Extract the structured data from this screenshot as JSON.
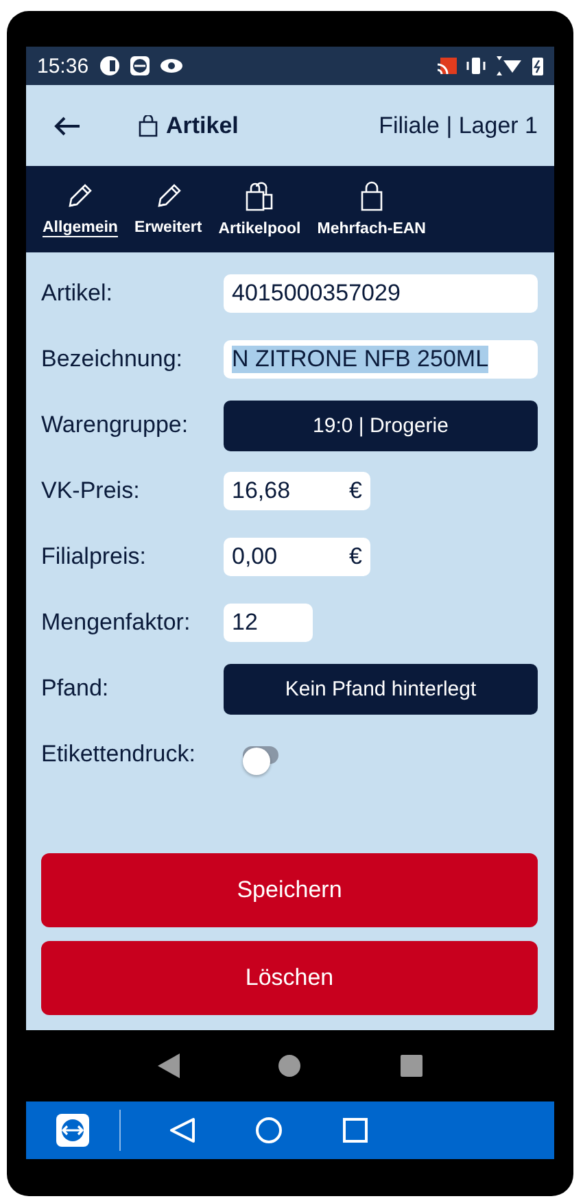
{
  "status_bar": {
    "time": "15:36"
  },
  "app_bar": {
    "title": "Artikel",
    "location": "Filiale | Lager 1"
  },
  "tabs": [
    {
      "label": "Allgemein",
      "kind": "pencil",
      "selected": true
    },
    {
      "label": "Erweitert",
      "kind": "pencil",
      "selected": false
    },
    {
      "label": "Artikelpool",
      "kind": "bags",
      "selected": false
    },
    {
      "label": "Mehrfach-EAN",
      "kind": "bag",
      "selected": false
    }
  ],
  "fields": [
    {
      "label": "Artikel:",
      "kind": "text",
      "value": "4015000357029",
      "highlighted": false
    },
    {
      "label": "Bezeichnung:",
      "kind": "text",
      "value": "N ZITRONE NFB 250ML",
      "highlighted": true
    },
    {
      "label": "Warengruppe:",
      "kind": "button",
      "value": "19:0 | Drogerie"
    },
    {
      "label": "VK-Preis:",
      "kind": "price",
      "value": "16,68",
      "currency": "€"
    },
    {
      "label": "Filialpreis:",
      "kind": "price",
      "value": "0,00",
      "currency": "€"
    },
    {
      "label": "Mengenfaktor:",
      "kind": "short",
      "value": "12"
    },
    {
      "label": "Pfand:",
      "kind": "button",
      "value": "Kein Pfand hinterlegt"
    },
    {
      "label": "Etikettendruck:",
      "kind": "toggle",
      "on": false
    }
  ],
  "buttons": [
    "Speichern",
    "Löschen"
  ]
}
